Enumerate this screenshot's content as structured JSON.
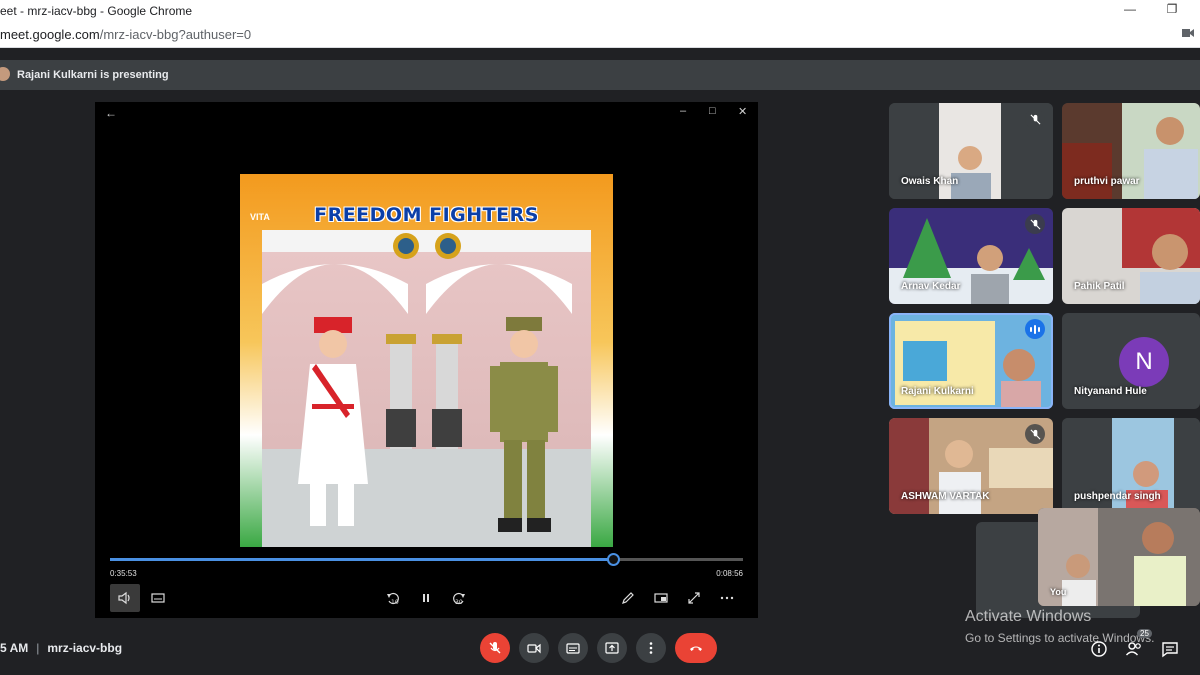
{
  "browser": {
    "title": "eet - mrz-iacv-bbg - Google Chrome",
    "url_host": "meet.google.com",
    "url_path": "/mrz-iacv-bbg?authuser=0"
  },
  "presenting": {
    "text": "Rajani Kulkarni is presenting"
  },
  "player": {
    "frame_title": "FREEDOM FIGHTERS",
    "logo_text": "VITA",
    "elapsed": "0:35:53",
    "remaining": "0:08:56",
    "progress": 0.795
  },
  "participants": [
    {
      "name": "Owais Khan",
      "muted": true
    },
    {
      "name": "pruthvi pawar",
      "muted": false
    },
    {
      "name": "Arnav Kedar",
      "muted": true
    },
    {
      "name": "Pahik Patil",
      "muted": false
    },
    {
      "name": "Rajani Kulkarni",
      "muted": false,
      "speaking": true
    },
    {
      "name": "Nityanand Hule",
      "muted": false,
      "initial": "N"
    },
    {
      "name": "ASHWAM VARTAK",
      "muted": false
    },
    {
      "name": "pushpendar singh",
      "muted": false
    }
  ],
  "self": {
    "name": "You"
  },
  "watermark": {
    "line1": "Activate Windows",
    "line2": "Go to Settings to activate Windows."
  },
  "meeting": {
    "time": "5 AM",
    "code": "mrz-iacv-bbg",
    "participant_count": "25"
  },
  "colors": {
    "background": "#202124",
    "hangup": "#ea4335",
    "accent": "#4a90e2",
    "avatar": "#7b3bb8"
  }
}
